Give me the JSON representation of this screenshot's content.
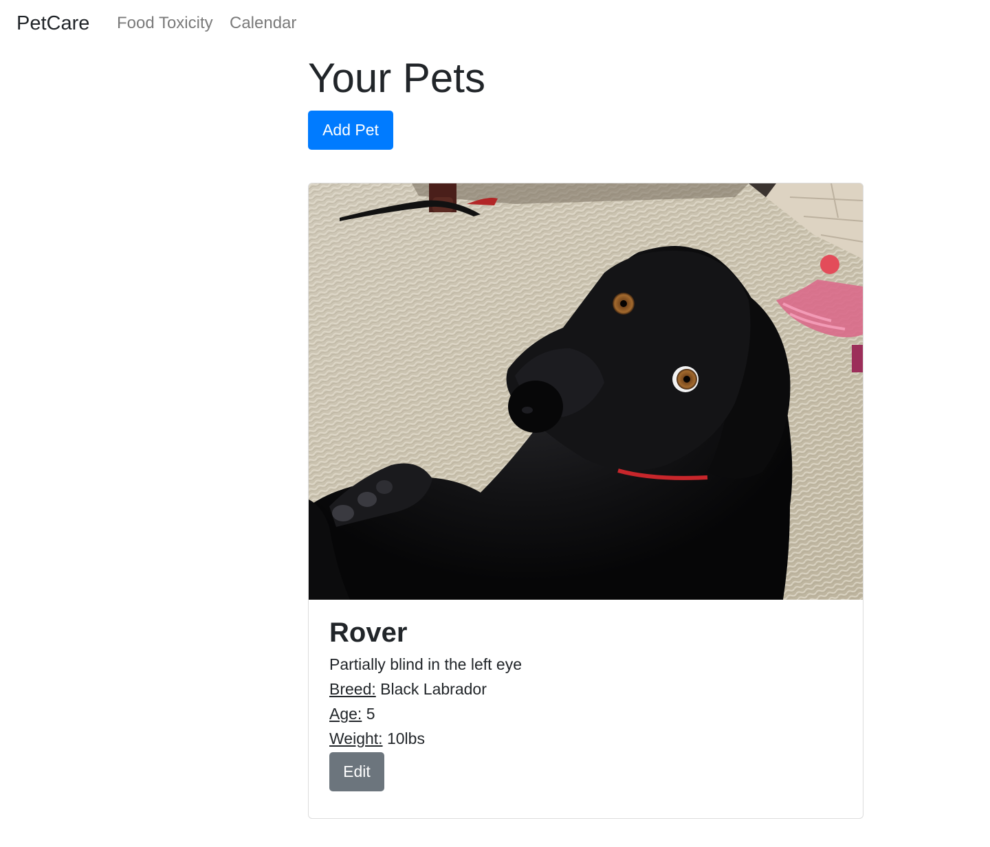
{
  "nav": {
    "brand": "PetCare",
    "links": [
      "Food Toxicity",
      "Calendar"
    ]
  },
  "main": {
    "title": "Your Pets",
    "add_button": "Add Pet"
  },
  "pets": [
    {
      "name": "Rover",
      "description": "Partially blind in the left eye",
      "breed_label": "Breed:",
      "breed": "Black Labrador",
      "age_label": "Age:",
      "age": "5",
      "weight_label": "Weight:",
      "weight": "10lbs",
      "edit_button": "Edit",
      "photo": "black-labrador-photo"
    }
  ],
  "colors": {
    "primary": "#007bff",
    "secondary": "#6c757d",
    "nav_link": "#7a7a7a",
    "text": "#212529"
  }
}
